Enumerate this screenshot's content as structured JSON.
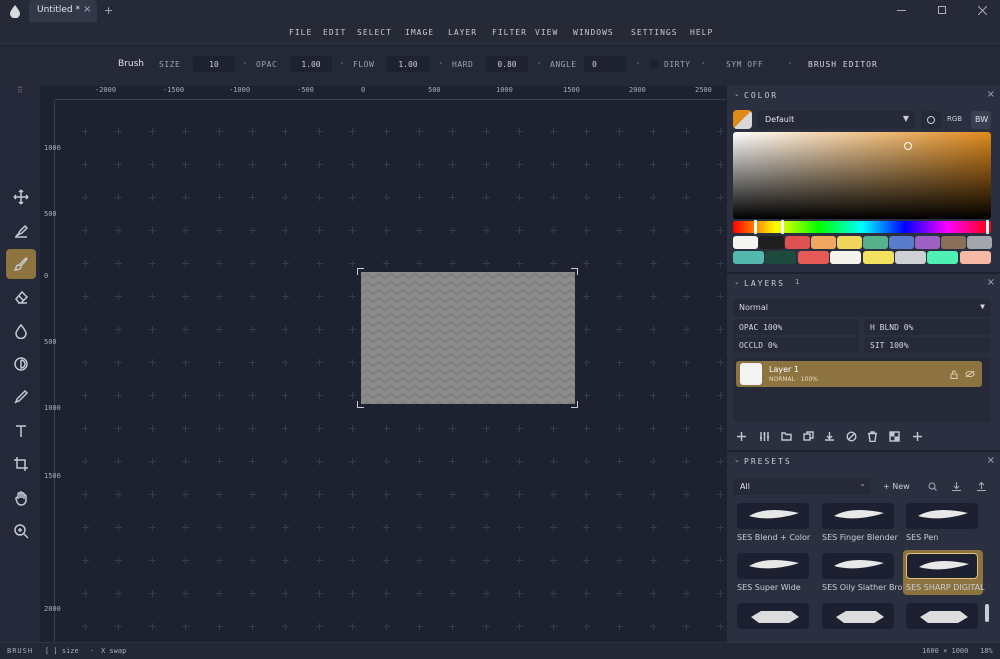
{
  "titlebar": {
    "tab_label": "Untitled *",
    "close_glyph": "×",
    "add_tab_glyph": "+",
    "logo_icon": "droplet-icon"
  },
  "menu": [
    "FILE",
    "EDIT",
    "SELECT",
    "IMAGE",
    "LAYER",
    "FILTER",
    "VIEW",
    "WINDOWS",
    "SETTINGS",
    "HELP"
  ],
  "toolbar": {
    "tool_name": "Brush",
    "size_label": "SIZE",
    "size_value": "10",
    "opac_label": "OPAC",
    "opac_value": "1.00",
    "flow_label": "FLOW",
    "flow_value": "1.00",
    "hard_label": "HARD",
    "hard_value": "0.80",
    "angle_label": "ANGLE",
    "angle_value": "0",
    "dirty_label": "DIRTY",
    "sym_label": "SYM OFF",
    "brush_editor_label": "BRUSH EDITOR"
  },
  "tools": [
    "move-icon",
    "smudge-icon",
    "brush-icon",
    "eraser-icon",
    "blur-icon",
    "dodge-icon",
    "pen-icon",
    "text-icon",
    "crop-icon",
    "hand-icon",
    "zoom-icon"
  ],
  "active_tool": "brush-icon",
  "hruler": [
    "-2000",
    "-1500",
    "-1000",
    "-500",
    "0",
    "500",
    "1000",
    "1500",
    "2000",
    "2500"
  ],
  "vruler": [
    "1000",
    "500",
    "0",
    "500",
    "1000",
    "1500",
    "2000"
  ],
  "color_panel": {
    "title": "COLOR",
    "palette_name": "Default",
    "rgb_label": "RGB",
    "bw_label": "BW",
    "accent": "#e08a1a",
    "swatches_row1": [
      "#f4f4f2",
      "#1e1e1e",
      "#e05252",
      "#f0a860",
      "#efd65a",
      "#56b08c",
      "#5a7ccc",
      "#9c62c4",
      "#8a7058",
      "#a3a6ad"
    ],
    "swatches_row2": [
      "#53b9ac",
      "#1e4a3e",
      "#e65a55",
      "#f5f3ee",
      "#f2e25e",
      "#cfd0d3",
      "#4ff0b4",
      "#f5b9a4"
    ]
  },
  "layers_panel": {
    "title": "LAYERS",
    "count": "1",
    "blend_mode": "Normal",
    "opac": "OPAC 100%",
    "h_blnd": "H BLND 0%",
    "occld": "OCCLD 0%",
    "sit": "SIT 100%",
    "layer_name": "Layer 1",
    "layer_sub": "NORMAL · 100%",
    "layer_color": "#8d7340"
  },
  "presets_panel": {
    "title": "PRESETS",
    "filter": "All",
    "new_label": "+ New",
    "items": [
      "SES Blend + Color",
      "SES Finger Blender",
      "SES Pen",
      "SES Super Wide",
      "SES Oily Slather Brol",
      "SES SHARP DIGITAL"
    ]
  },
  "status": {
    "mode": "BRUSH",
    "hint1": "[ ] size",
    "hint2": "X swap",
    "doc_size": "1600 × 1000",
    "zoom": "18%"
  }
}
